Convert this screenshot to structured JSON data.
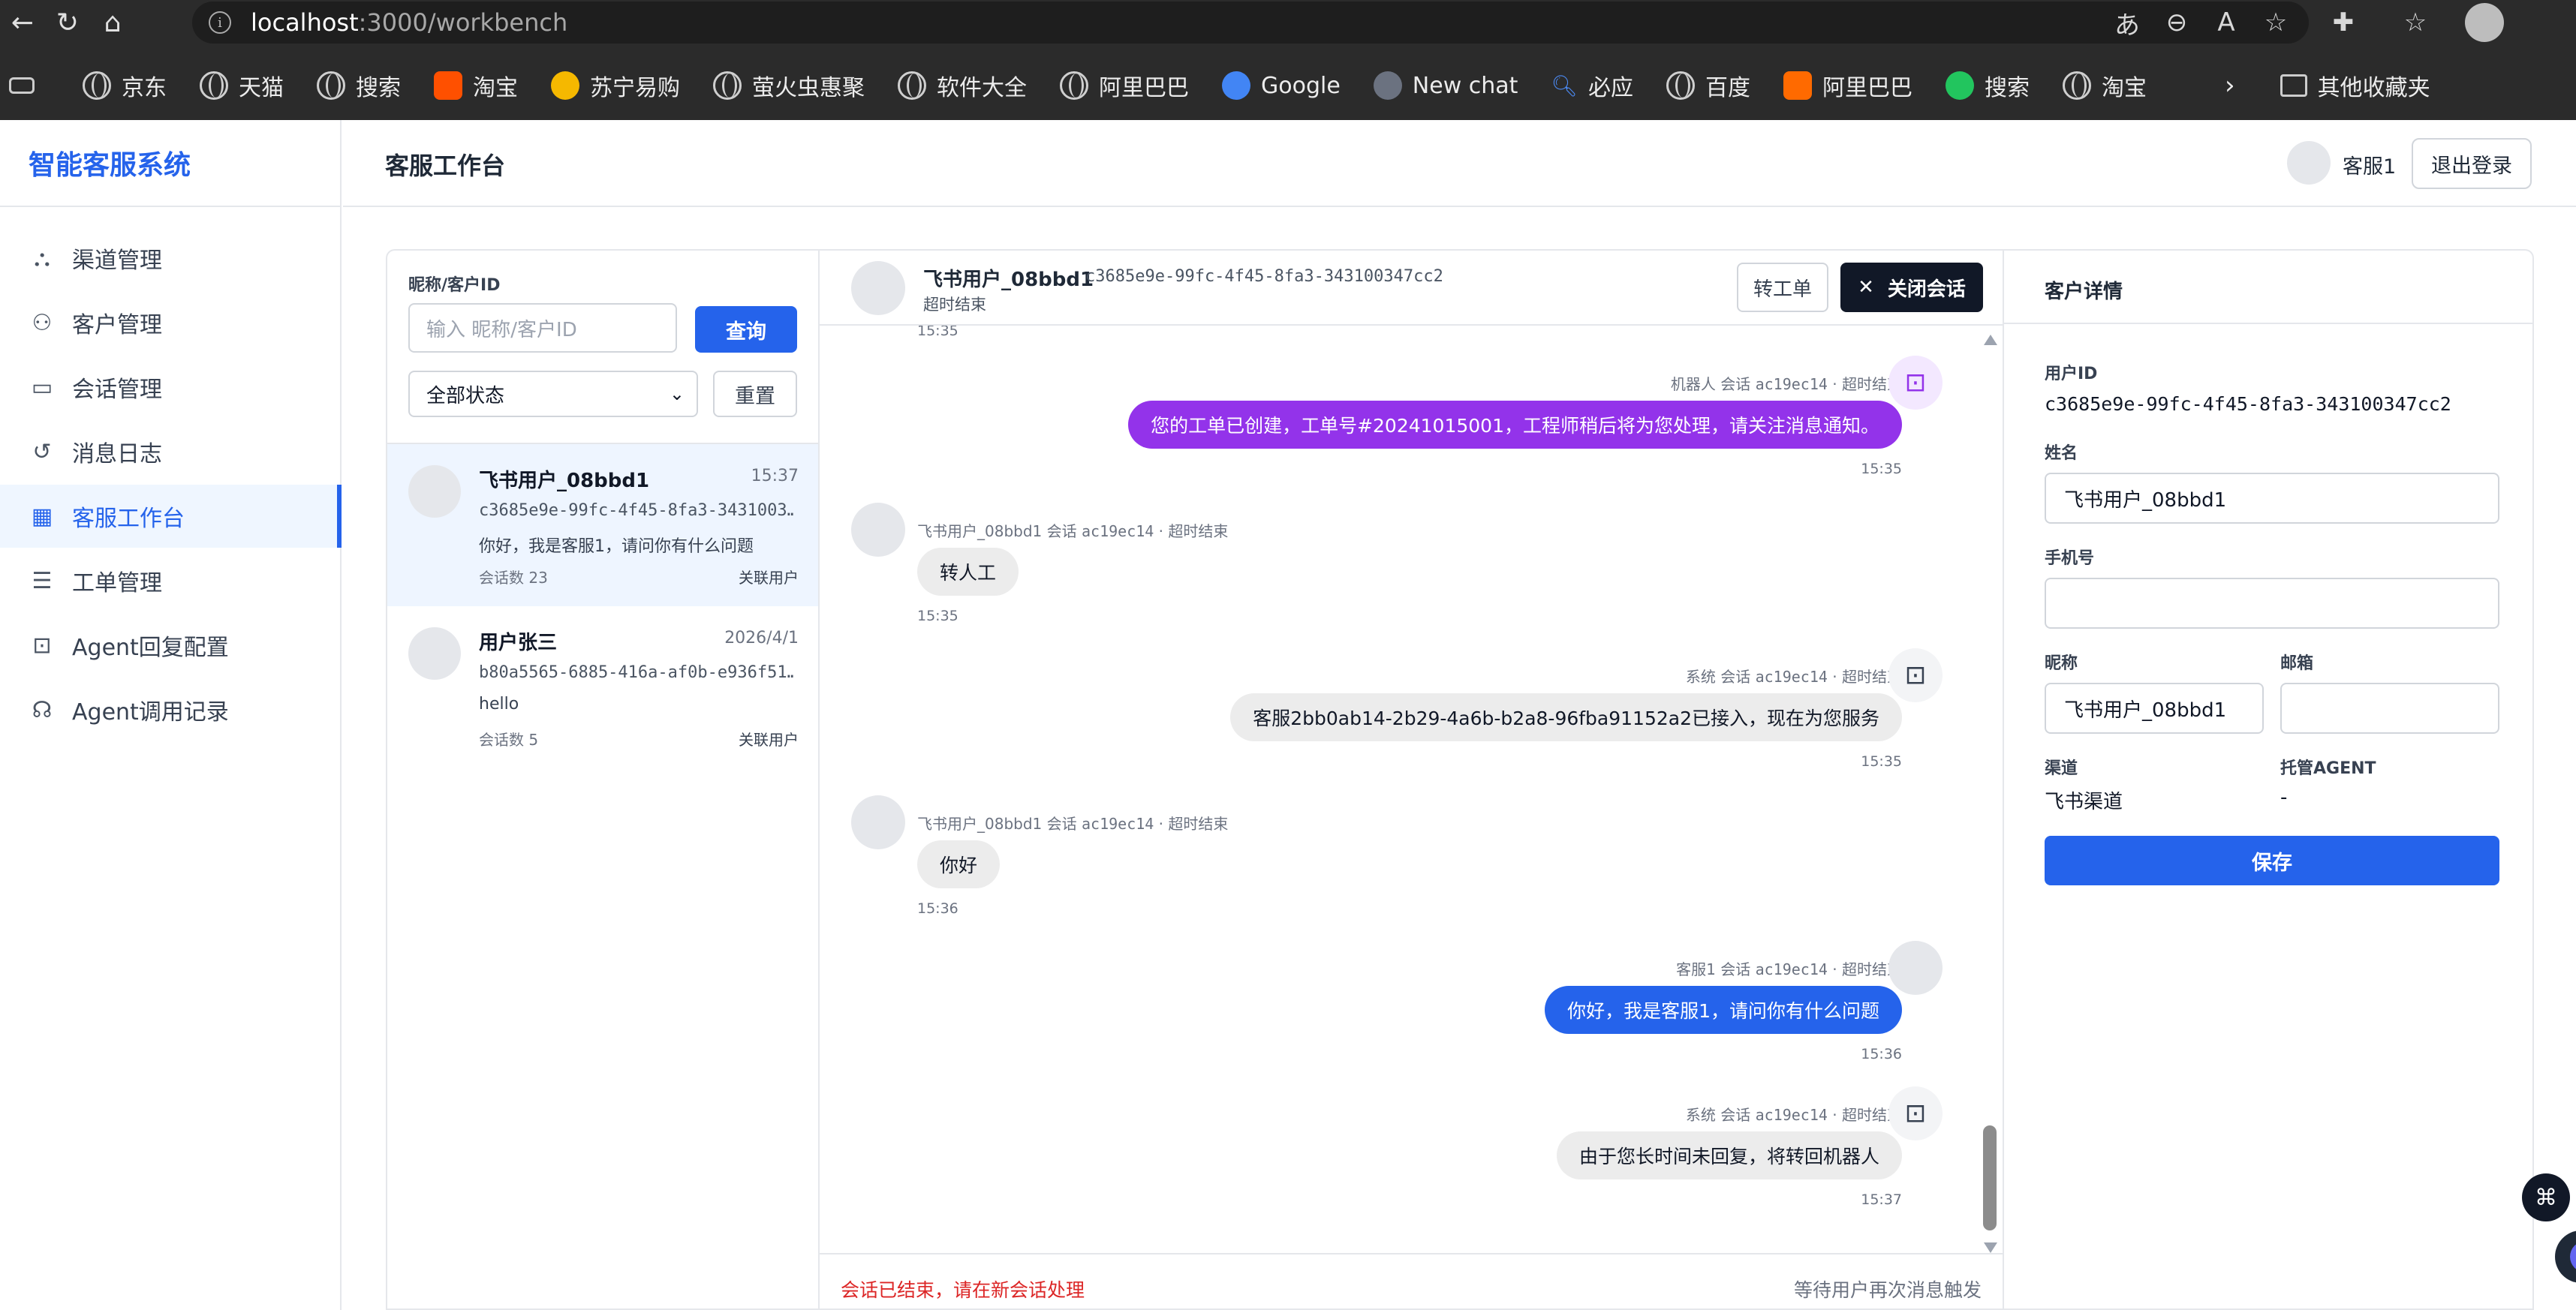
{
  "browser": {
    "url_host": "localhost",
    "url_path": ":3000/workbench",
    "bookmarks": [
      "京东",
      "天猫",
      "搜索",
      "淘宝",
      "苏宁易购",
      "萤火虫惠聚",
      "软件大全",
      "阿里巴巴",
      "Google",
      "New chat",
      "必应",
      "百度",
      "阿里巴巴",
      "搜索",
      "淘宝"
    ],
    "other_bookmarks": "其他收藏夹"
  },
  "app": {
    "brand": "智能客服系统",
    "nav": [
      "渠道管理",
      "客户管理",
      "会话管理",
      "消息日志",
      "客服工作台",
      "工单管理",
      "Agent回复配置",
      "Agent调用记录"
    ],
    "active_nav": "客服工作台",
    "page_title": "客服工作台",
    "user_name": "客服1",
    "logout": "退出登录"
  },
  "filter": {
    "label": "昵称/客户ID",
    "placeholder": "输入 昵称/客户ID",
    "query": "查询",
    "status": "全部状态",
    "reset": "重置"
  },
  "sessions": [
    {
      "name": "飞书用户_08bbd1",
      "time": "15:37",
      "id": "c3685e9e-99fc-4f45-8fa3-3431003…",
      "msg": "你好，我是客服1，请问你有什么问题",
      "count": "会话数  23",
      "link": "关联用户"
    },
    {
      "name": "用户张三",
      "time": "2026/4/1",
      "id": "b80a5565-6885-416a-af0b-e936f51…",
      "msg": "hello",
      "count": "会话数  5",
      "link": "关联用户"
    }
  ],
  "chat": {
    "name": "飞书用户_08bbd1",
    "id": "c3685e9e-99fc-4f45-8fa3-343100347cc2",
    "status": "超时结束",
    "transfer": "转工单",
    "close": "关闭会话",
    "top_time": "15:35",
    "messages": [
      {
        "sender": "机器人",
        "session": "会话",
        "sid": "ac19ec14",
        "state": "超时结束",
        "text": "您的工单已创建，工单号#20241015001，工程师稍后将为您处理，请关注消息通知。",
        "time": "15:35"
      },
      {
        "sender": "飞书用户_08bbd1",
        "session": "会话",
        "sid": "ac19ec14",
        "state": "超时结束",
        "text": "转人工",
        "time": "15:35"
      },
      {
        "sender": "系统",
        "session": "会话",
        "sid": "ac19ec14",
        "state": "超时结束",
        "text": "客服2bb0ab14-2b29-4a6b-b2a8-96fba91152a2已接入，现在为您服务",
        "time": "15:35"
      },
      {
        "sender": "飞书用户_08bbd1",
        "session": "会话",
        "sid": "ac19ec14",
        "state": "超时结束",
        "text": "你好",
        "time": "15:36"
      },
      {
        "sender": "客服1",
        "session": "会话",
        "sid": "ac19ec14",
        "state": "超时结束",
        "text": "你好，我是客服1，请问你有什么问题",
        "time": "15:36"
      },
      {
        "sender": "系统",
        "session": "会话",
        "sid": "ac19ec14",
        "state": "超时结束",
        "text": "由于您长时间未回复，将转回机器人",
        "time": "15:37"
      }
    ],
    "ended": "会话已结束，请在新会话处理",
    "waiting": "等待用户再次消息触发"
  },
  "detail": {
    "title": "客户详情",
    "user_id_label": "用户ID",
    "user_id": "c3685e9e-99fc-4f45-8fa3-343100347cc2",
    "name_label": "姓名",
    "name": "飞书用户_08bbd1",
    "phone_label": "手机号",
    "phone": "",
    "nick_label": "昵称",
    "nick": "飞书用户_08bbd1",
    "email_label": "邮箱",
    "email": "",
    "channel_label": "渠道",
    "channel": "飞书渠道",
    "agent_label": "托管AGENT",
    "agent": "-",
    "save": "保存"
  },
  "colors": {
    "primary": "#2563eb",
    "bot": "#9333ea",
    "danger": "#dc2626"
  }
}
